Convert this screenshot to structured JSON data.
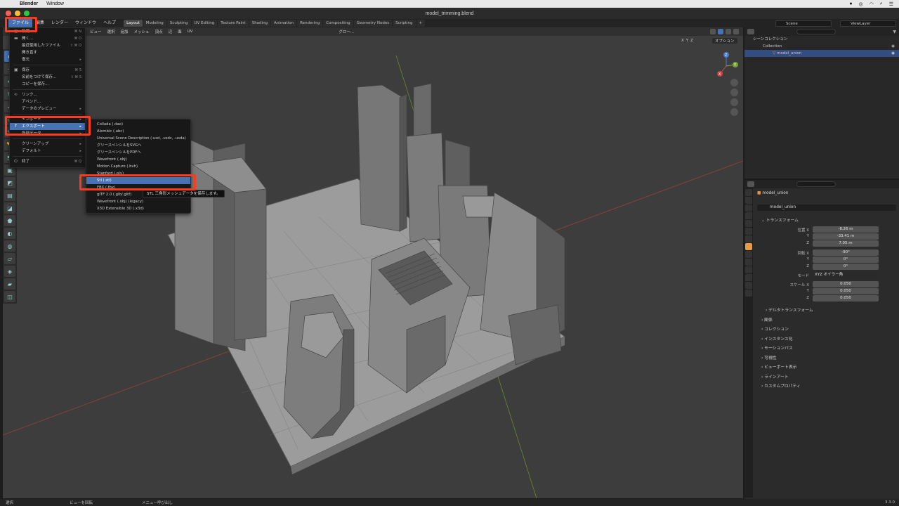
{
  "mac_menubar": {
    "app": "Blender",
    "window": "Window"
  },
  "window_title": "model_trimming.blend",
  "topbar": {
    "menus": [
      "ファイル",
      "編集",
      "レンダー",
      "ウィンドウ",
      "ヘルプ"
    ],
    "workspaces": [
      "Layout",
      "Modeling",
      "Sculpting",
      "UV Editing",
      "Texture Paint",
      "Shading",
      "Animation",
      "Rendering",
      "Compositing",
      "Geometry Nodes",
      "Scripting"
    ],
    "scene": "Scene",
    "view_layer": "ViewLayer"
  },
  "viewport": {
    "menus": [
      "ビュー",
      "選択",
      "追加",
      "メッシュ",
      "頂点",
      "辺",
      "面",
      "UV"
    ],
    "orientation": "グロー...",
    "options_label": "オプション",
    "axes": [
      "X",
      "Y",
      "Z"
    ],
    "gizmo": {
      "z": "Z",
      "y": "Y",
      "x": "X"
    }
  },
  "file_menu": {
    "items": [
      {
        "label": "新規",
        "shortcut": "⌘ N"
      },
      {
        "label": "開く...",
        "shortcut": "⌘ O"
      },
      {
        "label": "最近使用したファイル",
        "shortcut": "⇧ ⌘ O"
      },
      {
        "label": "開き直す",
        "shortcut": ""
      },
      {
        "label": "復元",
        "shortcut": ""
      },
      {
        "label": "保存",
        "shortcut": "⌘ S"
      },
      {
        "label": "名前をつけて保存...",
        "shortcut": "⇧ ⌘ S"
      },
      {
        "label": "コピーを保存...",
        "shortcut": ""
      },
      {
        "label": "リンク...",
        "shortcut": ""
      },
      {
        "label": "アペンド...",
        "shortcut": ""
      },
      {
        "label": "データのプレビュー",
        "shortcut": ""
      },
      {
        "label": "インポート",
        "shortcut": ""
      },
      {
        "label": "エクスポート",
        "shortcut": ""
      },
      {
        "label": "外部データ",
        "shortcut": ""
      },
      {
        "label": "クリーンアップ",
        "shortcut": ""
      },
      {
        "label": "デフォルト",
        "shortcut": ""
      },
      {
        "label": "終了",
        "shortcut": "⌘ Q"
      }
    ]
  },
  "export_menu": {
    "items": [
      "Collada (.dae)",
      "Alembic (.abc)",
      "Universal Scene Description (.usd, .usdc, .usda)",
      "グリースペンシルをSVGへ",
      "グリースペンシルをPDFへ",
      "Wavefront (.obj)",
      "Motion Capture (.bvh)",
      "Stanford (.ply)",
      "Stl (.stl)",
      "FBX (.fbx)",
      "glTF 2.0 (.glb/.gltf)",
      "Wavefront (.obj) (legacy)",
      "X3D Extensible 3D (.x3d)"
    ],
    "tooltip": "STL 三角形メッシュデータを保存します。"
  },
  "outliner": {
    "title": "シーンコレクション",
    "collection": "Collection",
    "object": "model_union"
  },
  "properties": {
    "object_name": "model_union",
    "object_field": "model_union",
    "section_transform": "トランスフォーム",
    "location_label": "位置 X",
    "location": [
      "-8.26 m",
      "-33.41 m",
      "7.05 m"
    ],
    "rotation_label": "回転 X",
    "rotation": [
      "-90°",
      "0°",
      "0°"
    ],
    "mode_label": "モード",
    "mode": "XYZ オイラー角",
    "scale_label": "スケール X",
    "scale": [
      "0.050",
      "0.050",
      "0.050"
    ],
    "axis_y": "Y",
    "axis_z": "Z",
    "sections": [
      "デルタトランスフォーム",
      "関係",
      "コレクション",
      "インスタンス化",
      "モーションパス",
      "可視性",
      "ビューポート表示",
      "ラインアート",
      "カスタムプロパティ"
    ]
  },
  "statusbar": {
    "left": "選択",
    "middle": "ビューを回転",
    "right": "メニュー呼び出し",
    "version": "3.3.0"
  },
  "colors": {
    "accent": "#4772b3",
    "highlight": "#ff3b1d",
    "viewport": "#3d3d3d"
  }
}
